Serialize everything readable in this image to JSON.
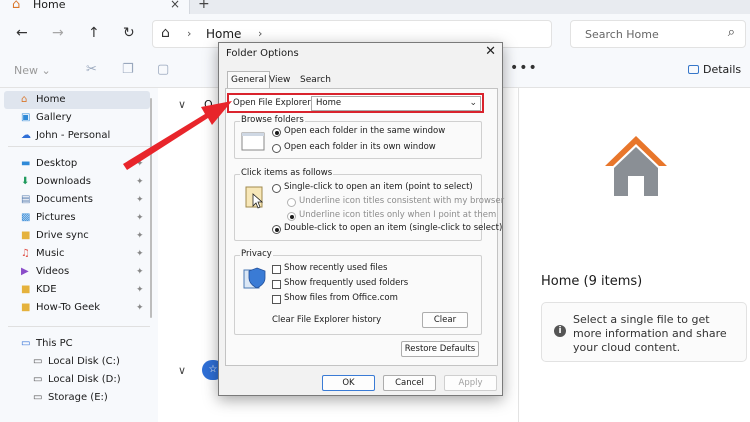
{
  "tab": {
    "label": "Home",
    "close": "×",
    "new_tab": "+"
  },
  "nav": {
    "back": "←",
    "forward": "→",
    "up": "↑",
    "refresh": "↻"
  },
  "address": {
    "home_glyph": "⌂",
    "sep": "›",
    "path": "Home"
  },
  "search": {
    "placeholder": "Search Home",
    "icon": "search-icon",
    "glyph": "⌕"
  },
  "toolbar": {
    "new_label": "New ⌄",
    "more": "•••",
    "details_label": "Details"
  },
  "sidebar": {
    "items": [
      {
        "label": "Home",
        "glyph": "⌂",
        "color": "#d9772c"
      },
      {
        "label": "Gallery",
        "glyph": "▣",
        "color": "#2f8ad8"
      },
      {
        "label": "John - Personal",
        "glyph": "☁",
        "color": "#2f6fd6"
      },
      {
        "label": "Desktop",
        "glyph": "▬",
        "color": "#2f8ad8"
      },
      {
        "label": "Downloads",
        "glyph": "⬇",
        "color": "#1f9a5c"
      },
      {
        "label": "Documents",
        "glyph": "▤",
        "color": "#5a7fb0"
      },
      {
        "label": "Pictures",
        "glyph": "▩",
        "color": "#3b8ed8"
      },
      {
        "label": "Drive sync",
        "glyph": "■",
        "color": "#e5b23c"
      },
      {
        "label": "Music",
        "glyph": "♫",
        "color": "#e0534a"
      },
      {
        "label": "Videos",
        "glyph": "▶",
        "color": "#8a4cc9"
      },
      {
        "label": "KDE",
        "glyph": "■",
        "color": "#e5b23c"
      },
      {
        "label": "How-To Geek",
        "glyph": "■",
        "color": "#e5b23c"
      },
      {
        "label": "This PC",
        "glyph": "▭",
        "color": "#2f6fd6"
      },
      {
        "label": "Local Disk (C:)",
        "glyph": "▭",
        "color": "#555"
      },
      {
        "label": "Local Disk (D:)",
        "glyph": "▭",
        "color": "#555"
      },
      {
        "label": "Storage (E:)",
        "glyph": "▭",
        "color": "#555"
      }
    ],
    "pin_glyph": "📌"
  },
  "main": {
    "section_first_letter": "Q",
    "chevron": "∨",
    "badge_glyph": "☆"
  },
  "details_pane": {
    "title": "Home (9 items)",
    "info_glyph": "i",
    "info_text": "Select a single file to get more information and share your cloud content."
  },
  "dialog": {
    "title": "Folder Options",
    "close": "✕",
    "tabs": [
      "General",
      "View",
      "Search"
    ],
    "open_label": "Open File Explorer to:",
    "open_value": "Home",
    "open_arrow": "⌄",
    "browse": {
      "title": "Browse folders",
      "options": [
        "Open each folder in the same window",
        "Open each folder in its own window"
      ],
      "selected": 0
    },
    "click": {
      "title": "Click items as follows",
      "single": "Single-click to open an item (point to select)",
      "underline_browser": "Underline icon titles consistent with my browser",
      "underline_point": "Underline icon titles only when I point at them",
      "double": "Double-click to open an item (single-click to select)",
      "selected": "double"
    },
    "privacy": {
      "title": "Privacy",
      "options": [
        "Show recently used files",
        "Show frequently used folders",
        "Show files from Office.com"
      ],
      "clear_label": "Clear File Explorer history",
      "clear_button": "Clear"
    },
    "restore_button": "Restore Defaults",
    "ok": "OK",
    "cancel": "Cancel",
    "apply": "Apply"
  },
  "colors": {
    "highlight_box": "#d9232d",
    "arrow": "#e8252b",
    "accent": "#3a7bd5",
    "home_roof": "#e8762b",
    "home_body": "#8a8f95"
  }
}
